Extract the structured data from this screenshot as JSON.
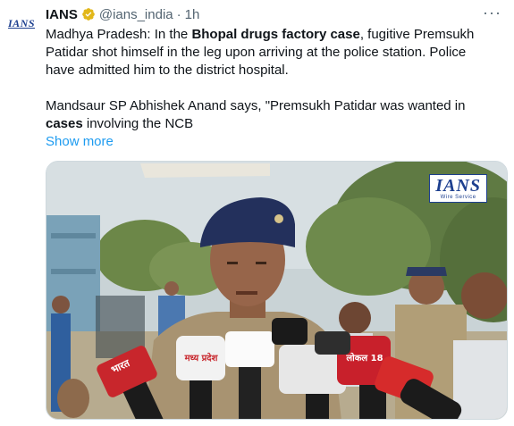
{
  "tweet": {
    "avatar_text": "IANS",
    "display_name": "IANS",
    "handle": "@ians_india",
    "separator": "·",
    "time": "1h",
    "more_icon": "more-horizontal-icon",
    "verified_icon": "verified-badge-icon",
    "verified_color": "#e2b719",
    "paragraph1": {
      "part1": "Madhya Pradesh: In the ",
      "bold1": "Bhopal drugs factory case",
      "part2": ", fugitive Premsukh Patidar shot himself in the leg upon arriving at the police station. Police have admitted him to the district hospital."
    },
    "paragraph2": {
      "part1": "Mandsaur SP Abhishek Anand says, \"Premsukh Patidar was wanted in ",
      "bold1": "cases",
      "part2": " involving the NCB"
    },
    "show_more": "Show more",
    "link_color": "#1d9bf0"
  },
  "media": {
    "watermark_main": "IANS",
    "watermark_sub": "Wire Service",
    "mic_label_1": "भारत",
    "mic_label_2": "मध्य प्रदेश",
    "mic_label_3": "लोकल 18"
  }
}
